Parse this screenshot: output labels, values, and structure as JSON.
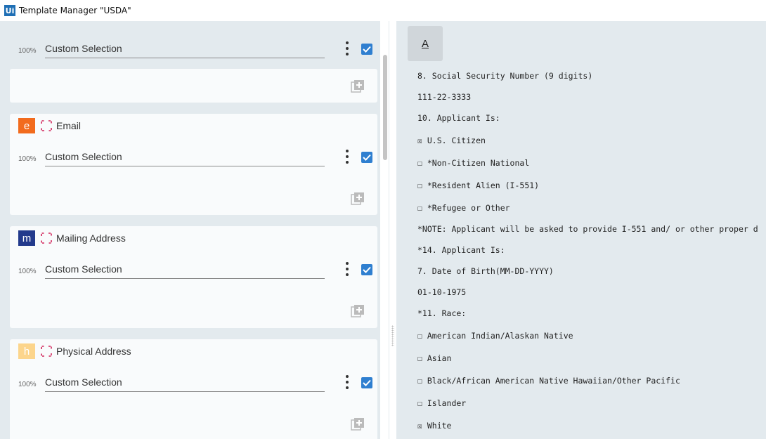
{
  "window": {
    "logo_text": "Ui",
    "title": "Template Manager \"USDA\""
  },
  "colors": {
    "panel_bg": "#e3eaee",
    "card_bg": "#f9fbfc",
    "checkbox_blue": "#2f7fd0",
    "bracket_red": "#d1245a"
  },
  "cards": [
    {
      "has_header": false,
      "percent": "100%",
      "selection": "Custom Selection",
      "checked": true
    },
    {
      "has_header": true,
      "badge_letter": "e",
      "badge_color": "#f26b1d",
      "field_name": "Email",
      "percent": "100%",
      "selection": "Custom Selection",
      "checked": true
    },
    {
      "has_header": true,
      "badge_letter": "m",
      "badge_color": "#233a8c",
      "field_name": "Mailing Address",
      "percent": "100%",
      "selection": "Custom Selection",
      "checked": true
    },
    {
      "has_header": true,
      "badge_letter": "h",
      "badge_color": "#fcd58c",
      "field_name": "Physical Address",
      "percent": "100%",
      "selection": "Custom Selection",
      "checked": true
    }
  ],
  "document": {
    "font_button_label": "A",
    "lines": [
      "8. Social Security Number (9 digits)",
      "111-22-3333",
      "10. Applicant Is:",
      "☒ U.S. Citizen",
      "☐ *Non-Citizen National",
      "☐ *Resident Alien (I-551)",
      "☐ *Refugee or Other",
      "*NOTE: Applicant will be asked to provide I-551 and/ or other proper d",
      "*14. Applicant Is:",
      "7. Date of Birth(MM-DD-YYYY)",
      "01-10-1975",
      "*11. Race:",
      "☐ American Indian/Alaskan Native",
      "☐ Asian",
      "☐ Black/African American Native Hawaiian/Other Pacific",
      "☐ Islander",
      "☒ White"
    ]
  }
}
